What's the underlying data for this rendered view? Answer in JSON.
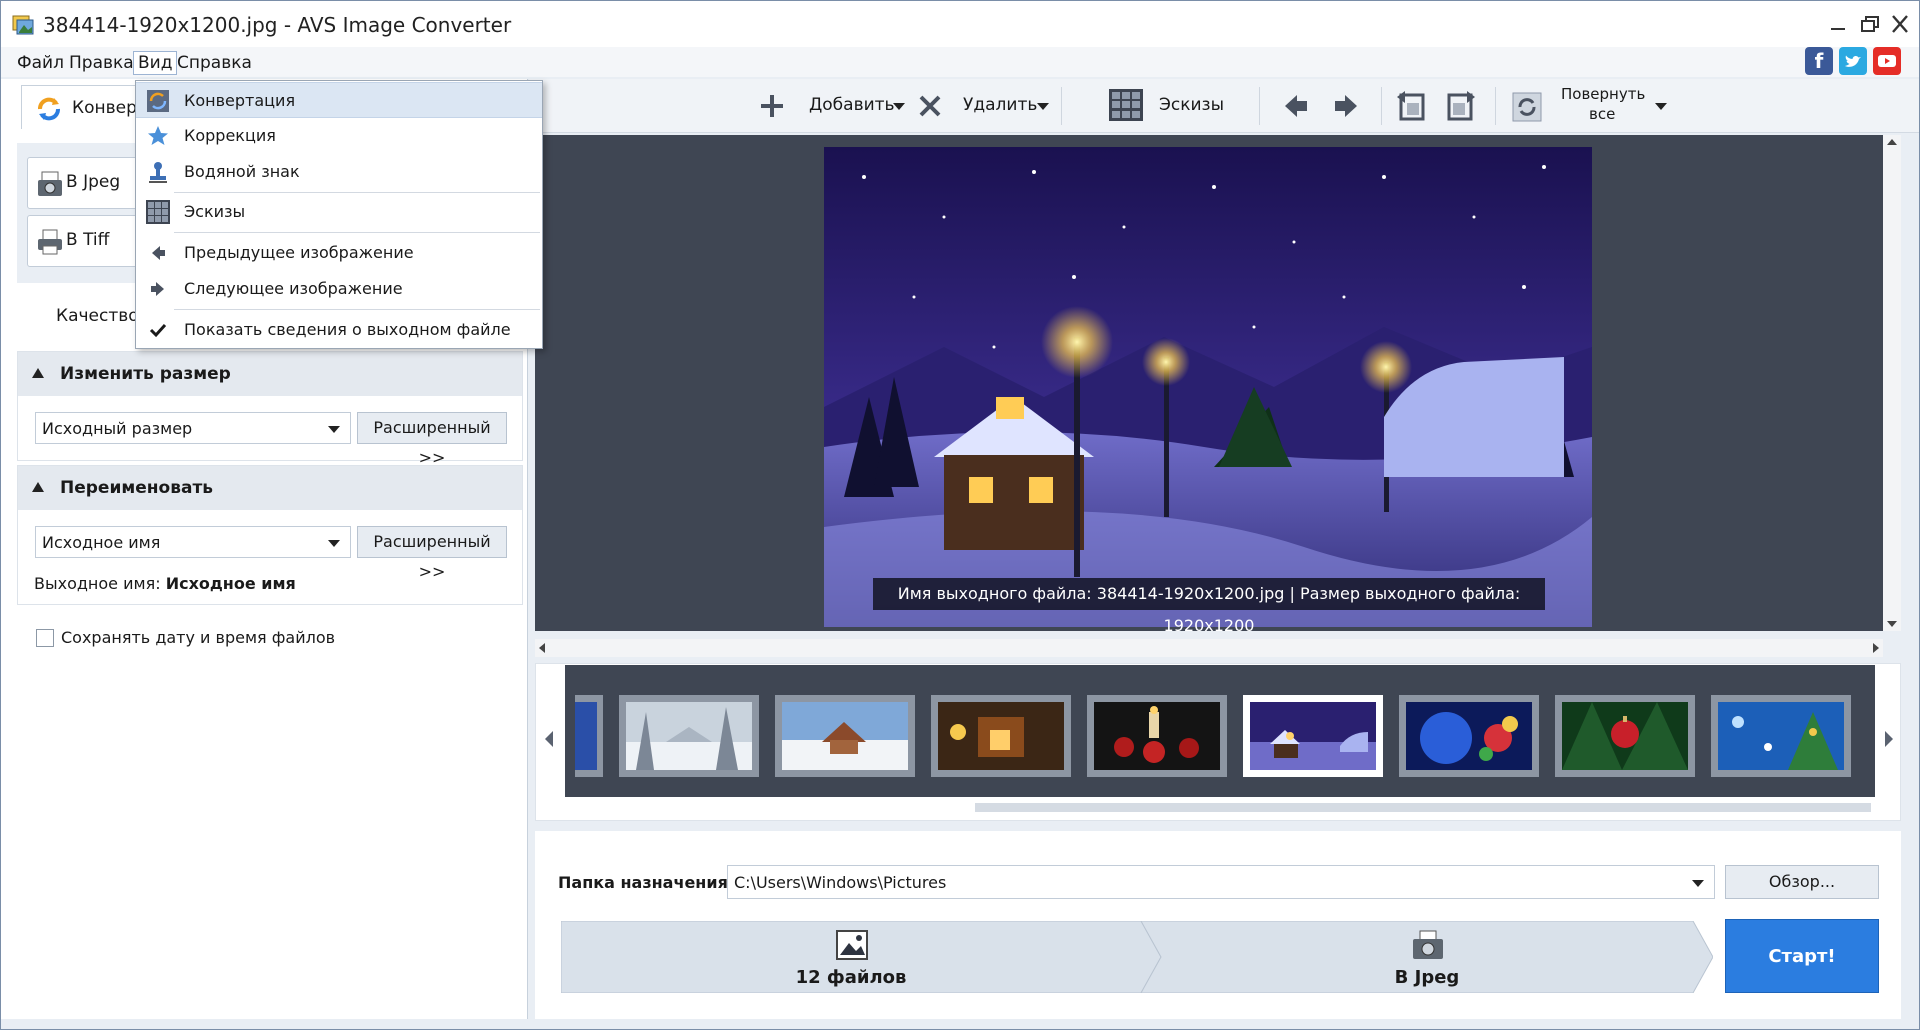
{
  "window": {
    "title": "384414-1920x1200.jpg - AVS Image Converter",
    "icon": "app-icon"
  },
  "menu": {
    "items": [
      "Файл",
      "Правка",
      "Вид",
      "Справка"
    ],
    "open_menu": "Вид"
  },
  "dropdown": {
    "items": [
      {
        "label": "Конвертация",
        "icon": "convert-icon",
        "highlighted": true
      },
      {
        "label": "Коррекция",
        "icon": "star-icon"
      },
      {
        "label": "Водяной знак",
        "icon": "stamp-icon"
      },
      {
        "label": "Эскизы",
        "icon": "thumbnails-icon"
      },
      {
        "label": "Предыдущее изображение",
        "icon": "arrow-left-icon"
      },
      {
        "label": "Следующее изображение",
        "icon": "arrow-right-icon"
      },
      {
        "label": "Показать сведения о выходном файле",
        "icon": "check-icon",
        "checked": true
      }
    ]
  },
  "social": [
    "facebook-icon",
    "twitter-icon",
    "youtube-icon"
  ],
  "left_panel": {
    "tab_label": "Конверт",
    "formats": [
      "В Jpeg",
      "В Tiff"
    ],
    "quality_label": "Качество:",
    "resize": {
      "title": "Изменить размер",
      "value": "Исходный размер",
      "advanced": "Расширенный >>"
    },
    "rename": {
      "title": "Переименовать",
      "value": "Исходное имя",
      "advanced": "Расширенный >>",
      "output_label": "Выходное имя:",
      "output_value": "Исходное имя"
    },
    "keep_date": {
      "label": "Сохранять дату и время файлов",
      "checked": false
    }
  },
  "toolbar": {
    "add": "Добавить",
    "delete": "Удалить",
    "thumbnails": "Эскизы",
    "rotate_all_line1": "Повернуть",
    "rotate_all_line2": "все"
  },
  "preview": {
    "caption": "Имя выходного файла: 384414-1920x1200.jpg | Размер выходного файла: 1920x1200"
  },
  "thumbnails": {
    "items": [
      "winter-forest",
      "snowy-village",
      "cozy-house",
      "candles-ornaments",
      "winter-night-village",
      "blue-ornaments",
      "red-ornament-tree",
      "blue-sparkle-tree"
    ],
    "selected_index": 4
  },
  "bottom": {
    "dest_label": "Папка назначения:",
    "dest_value": "C:\\Users\\Windows\\Pictures",
    "browse": "Обзор...",
    "step1": "12 файлов",
    "step2": "В Jpeg",
    "start": "Старт!"
  },
  "colors": {
    "accent": "#2b7de0",
    "menu_highlight": "#dbe6f3",
    "preview_bg": "#3f4653"
  }
}
